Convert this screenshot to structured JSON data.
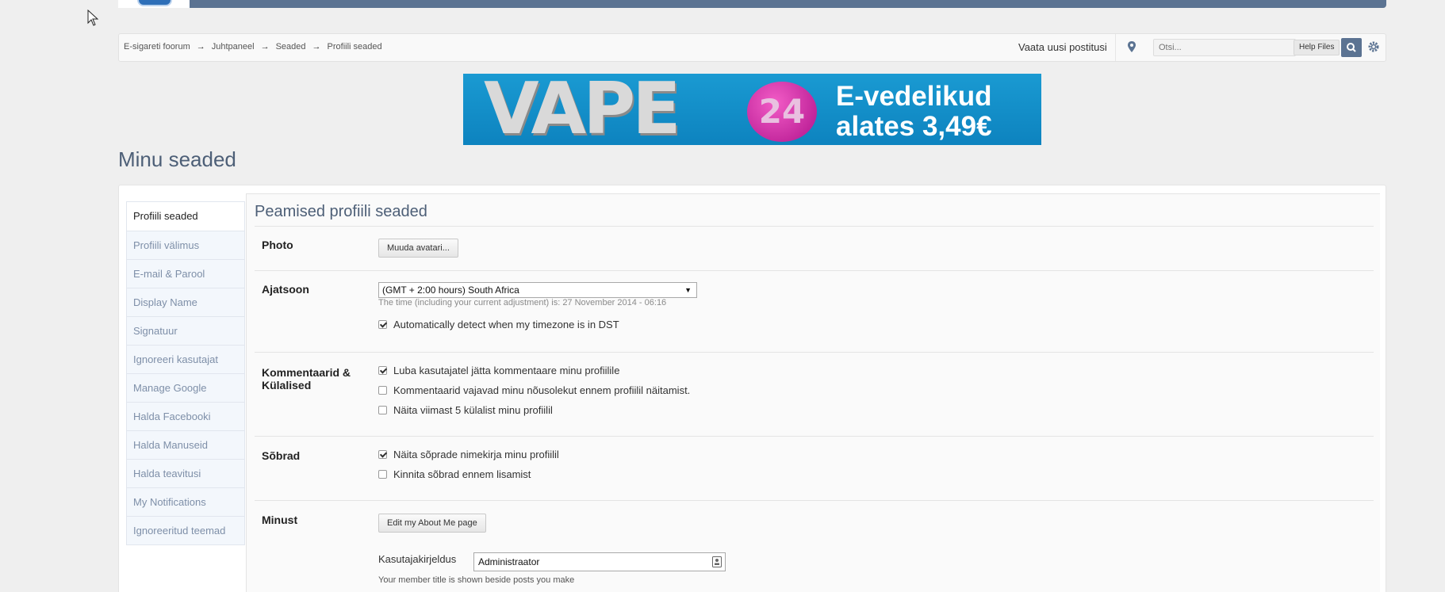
{
  "breadcrumb": {
    "items": [
      "E-sigareti foorum",
      "Juhtpaneel",
      "Seaded",
      "Profiili seaded"
    ],
    "separator": "→"
  },
  "header": {
    "new_posts_label": "Vaata uusi postitusi",
    "search_placeholder": "Otsi...",
    "help_files_label": "Help Files",
    "accent_color": "#5b7392"
  },
  "banner": {
    "brand": "VAPE",
    "badge": "24",
    "line1": "E-vedelikud",
    "line2": "alates 3,49€"
  },
  "page": {
    "title": "Minu seaded"
  },
  "sidebar": {
    "items": [
      {
        "label": "Profiili seaded",
        "active": true
      },
      {
        "label": "Profiili välimus",
        "active": false
      },
      {
        "label": "E-mail & Parool",
        "active": false
      },
      {
        "label": "Display Name",
        "active": false
      },
      {
        "label": "Signatuur",
        "active": false
      },
      {
        "label": "Ignoreeri kasutajat",
        "active": false
      },
      {
        "label": "Manage Google",
        "active": false
      },
      {
        "label": "Halda Facebooki",
        "active": false
      },
      {
        "label": "Halda Manuseid",
        "active": false
      },
      {
        "label": "Halda teavitusi",
        "active": false
      },
      {
        "label": "My Notifications",
        "active": false
      },
      {
        "label": "Ignoreeritud teemad",
        "active": false
      }
    ]
  },
  "main": {
    "section_title": "Peamised profiili seaded",
    "photo": {
      "label": "Photo",
      "button": "Muuda avatari..."
    },
    "timezone": {
      "label": "Ajatsoon",
      "selected": "(GMT + 2:00 hours) South Africa",
      "hint": "The time (including your current adjustment) is: 27 November 2014 - 06:16",
      "dst_label": "Automatically detect when my timezone is in DST",
      "dst_checked": true
    },
    "comments": {
      "label": "Kommentaarid & Külalised",
      "options": [
        {
          "label": "Luba kasutajatel jätta kommentaare minu profiilile",
          "checked": true
        },
        {
          "label": "Kommentaarid vajavad minu nõusolekut ennem profiilil näitamist.",
          "checked": false
        },
        {
          "label": "Näita viimast 5 külalist minu profiilil",
          "checked": false
        }
      ]
    },
    "friends": {
      "label": "Sõbrad",
      "options": [
        {
          "label": "Näita sõprade nimekirja minu profiilil",
          "checked": true
        },
        {
          "label": "Kinnita sõbrad ennem lisamist",
          "checked": false
        }
      ]
    },
    "about": {
      "label": "Minust",
      "button": "Edit my About Me page",
      "title_label": "Kasutajakirjeldus",
      "title_value": "Administraator",
      "title_hint": "Your member title is shown beside posts you make"
    }
  }
}
